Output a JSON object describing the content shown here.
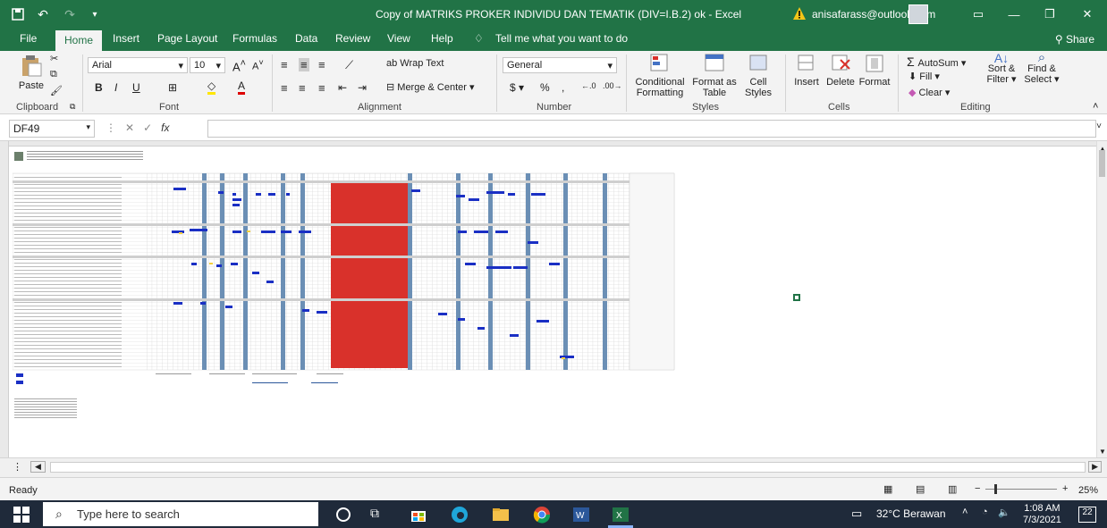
{
  "window": {
    "title": "Copy of MATRIKS PROKER INDIVIDU DAN TEMATIK (DIV=I.B.2) ok  -  Excel",
    "account": "anisafarass@outlook.com"
  },
  "tabs": [
    "File",
    "Home",
    "Insert",
    "Page Layout",
    "Formulas",
    "Data",
    "Review",
    "View",
    "Help"
  ],
  "tell_me": "Tell me what you want to do",
  "share": "Share",
  "ribbon": {
    "clipboard": {
      "paste": "Paste",
      "label": "Clipboard"
    },
    "font": {
      "name": "Arial",
      "size": "10",
      "label": "Font"
    },
    "alignment": {
      "wrap": "Wrap Text",
      "merge": "Merge & Center",
      "label": "Alignment"
    },
    "number": {
      "format": "General",
      "label": "Number",
      "currency": "$",
      "percent": "%",
      "comma": ","
    },
    "styles": {
      "conditional": "Conditional",
      "formatting": "Formatting",
      "format_as": "Format as",
      "table": "Table",
      "cell": "Cell",
      "styles_btn": "Styles",
      "label": "Styles"
    },
    "cells": {
      "insert": "Insert",
      "delete": "Delete",
      "format": "Format",
      "label": "Cells"
    },
    "editing": {
      "autosum": "AutoSum",
      "fill": "Fill",
      "clear": "Clear",
      "sort": "Sort &",
      "filter": "Filter",
      "find": "Find &",
      "select": "Select",
      "label": "Editing"
    }
  },
  "formula_bar": {
    "name_box": "DF49",
    "fx": "fx",
    "value": ""
  },
  "status": {
    "ready": "Ready",
    "zoom": "25%"
  },
  "taskbar": {
    "search_placeholder": "Type here to search",
    "weather": "32°C  Berawan",
    "time": "1:08 AM",
    "date": "7/3/2021",
    "notifications": "22"
  },
  "colors": {
    "excel_green": "#217346",
    "bar_blue": "#1a2fc4",
    "highlight_red": "#d9312b",
    "column_blue": "#6b8fb5"
  }
}
